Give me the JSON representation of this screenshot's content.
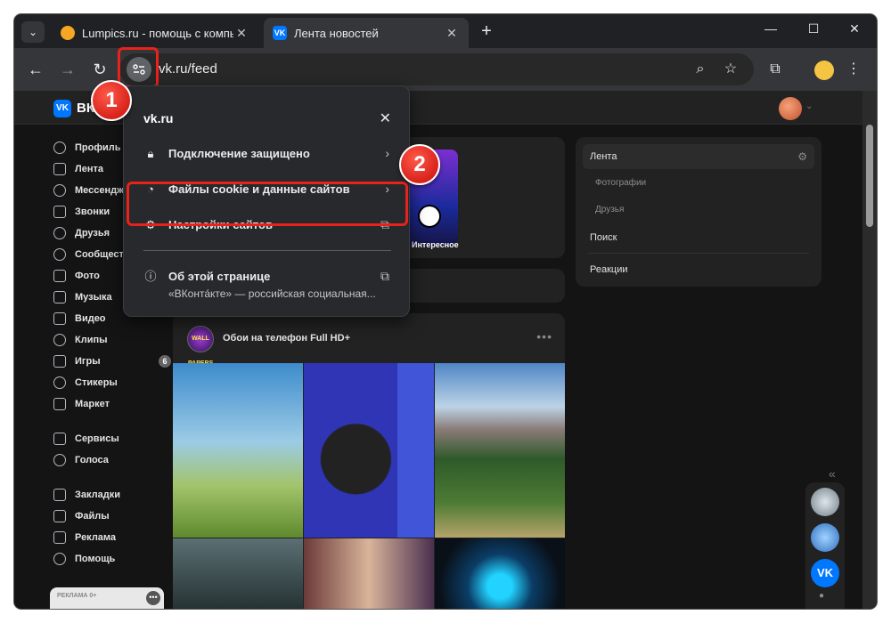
{
  "tabs": [
    {
      "title": "Lumpics.ru - помощь с компь",
      "favicon": "orange-circle",
      "active": false
    },
    {
      "title": "Лента новостей",
      "favicon": "vk-logo",
      "active": true
    }
  ],
  "window_controls": {
    "minimize": "—",
    "maximize": "☐",
    "close": "✕"
  },
  "toolbar": {
    "url": "vk.ru/feed",
    "new_tab": "+"
  },
  "vk": {
    "logo": "VK",
    "wordmark": "ВК",
    "sidebar": [
      {
        "label": "Профиль"
      },
      {
        "label": "Лента"
      },
      {
        "label": "Мессенджер"
      },
      {
        "label": "Звонки"
      },
      {
        "label": "Друзья"
      },
      {
        "label": "Сообщества"
      },
      {
        "label": "Фото"
      },
      {
        "label": "Музыка"
      },
      {
        "label": "Видео"
      },
      {
        "label": "Клипы"
      },
      {
        "label": "Игры",
        "badge": "6"
      },
      {
        "label": "Стикеры"
      },
      {
        "label": "Маркет"
      }
    ],
    "sidebar2": [
      {
        "label": "Сервисы"
      },
      {
        "label": "Голоса"
      }
    ],
    "sidebar3": [
      {
        "label": "Закладки"
      },
      {
        "label": "Файлы"
      },
      {
        "label": "Реклама"
      },
      {
        "label": "Помощь"
      }
    ],
    "ad_label": "РЕКЛАМА 0+",
    "story_label": "Интересное",
    "post": {
      "author": "Обои на телефон Full HD+",
      "avatar_text": "WALL PAPERS",
      "more": "•••"
    },
    "right_panel": {
      "items": [
        "Лента",
        "Фотографии",
        "Друзья",
        "Поиск",
        "Реакции"
      ]
    }
  },
  "popup": {
    "title": "vk.ru",
    "rows": [
      {
        "label": "Подключение защищено",
        "icon": "lock-icon"
      },
      {
        "label": "Файлы cookie и данные сайтов",
        "icon": "cookie-icon"
      },
      {
        "label": "Настройки сайтов",
        "icon": "gear-icon"
      },
      {
        "label": "Об этой странице",
        "icon": "info-icon"
      }
    ],
    "about_subtitle": "«ВКонта́кте» — российская социальная..."
  },
  "markers": [
    "1",
    "2"
  ],
  "colors": {
    "accent_red": "#e8221c",
    "vk_blue": "#0077ff",
    "page_bg": "#141414"
  }
}
